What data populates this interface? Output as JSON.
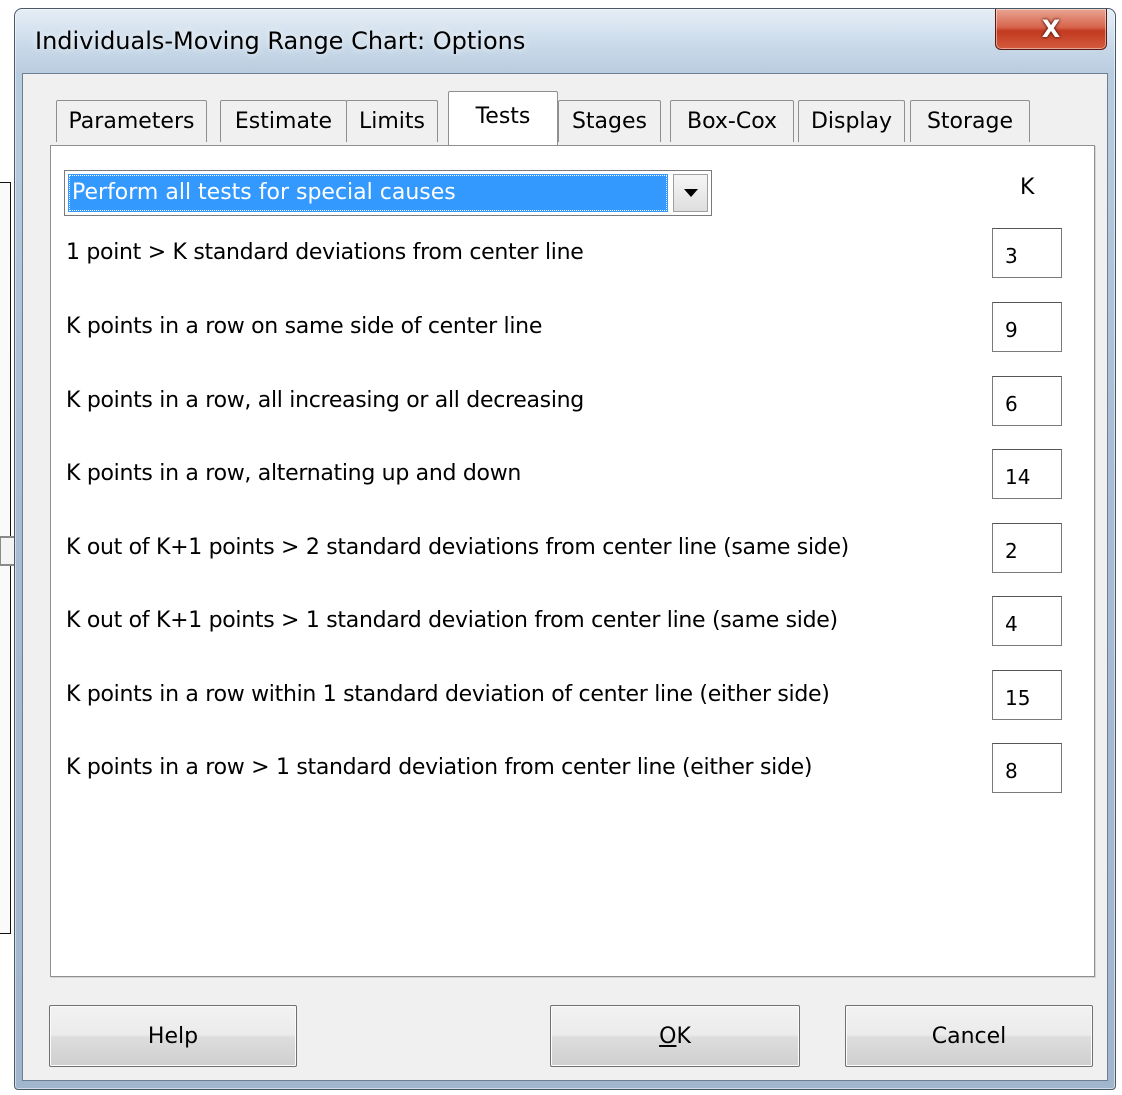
{
  "window": {
    "title": "Individuals-Moving Range Chart: Options",
    "close_glyph": "X"
  },
  "tabs": [
    {
      "label": "Parameters",
      "active": false
    },
    {
      "label": "Estimate",
      "active": false
    },
    {
      "label": "Limits",
      "active": false
    },
    {
      "label": "Tests",
      "active": true
    },
    {
      "label": "Stages",
      "active": false
    },
    {
      "label": "Box-Cox",
      "active": false
    },
    {
      "label": "Display",
      "active": false
    },
    {
      "label": "Storage",
      "active": false
    }
  ],
  "tests_panel": {
    "dropdown_value": "Perform all tests for special causes",
    "k_header": "K",
    "tests": [
      {
        "label": "1 point > K standard deviations from center line",
        "k": "3"
      },
      {
        "label": "K points in a row on same side of center line",
        "k": "9"
      },
      {
        "label": "K points in a row, all increasing or all decreasing",
        "k": "6"
      },
      {
        "label": "K points in a row, alternating up and down",
        "k": "14"
      },
      {
        "label": "K out of K+1 points > 2 standard deviations from center line (same side)",
        "k": "2"
      },
      {
        "label": "K out of K+1 points > 1 standard deviation from center line (same side)",
        "k": "4"
      },
      {
        "label": "K points in a row within 1 standard deviation of center line (either side)",
        "k": "15"
      },
      {
        "label": "K points in a row > 1 standard deviation from center line (either side)",
        "k": "8"
      }
    ]
  },
  "buttons": {
    "help": "Help",
    "ok_mnemonic": "O",
    "ok_rest": "K",
    "cancel": "Cancel"
  },
  "colors": {
    "selection": "#3399ff",
    "close_button": "#c23a20",
    "frame": "#a9bed4"
  },
  "icons": {
    "pointer": "arrow-right-icon",
    "dropdown": "chevron-down-icon",
    "close": "close-icon"
  }
}
